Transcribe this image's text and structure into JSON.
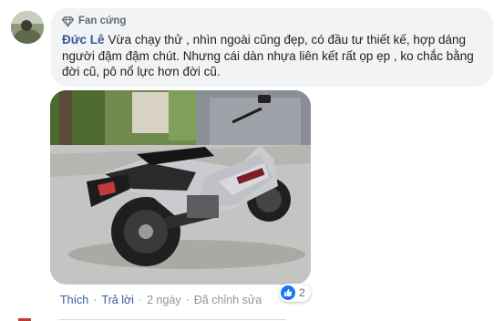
{
  "comment": {
    "badge": "Fan cứng",
    "author": "Đức Lê",
    "text": "Vừa chạy thử , nhìn ngoài cũng đẹp, có đầu tư thiết kế, hợp dáng người đậm đậm chút. Nhưng cái dàn nhựa liên kết rất ọp ẹp , ko chắc bằng đời cũ, pô nổ lực hơn đời cũ.",
    "actions": {
      "like": "Thích",
      "reply": "Trả lời",
      "time": "2 ngày",
      "edited": "Đã chỉnh sửa"
    },
    "reactions": {
      "count": "2",
      "icon": "like-icon"
    }
  },
  "colors": {
    "author": "#385898",
    "bubble": "#f2f3f5",
    "like_blue": "#1877f2"
  }
}
